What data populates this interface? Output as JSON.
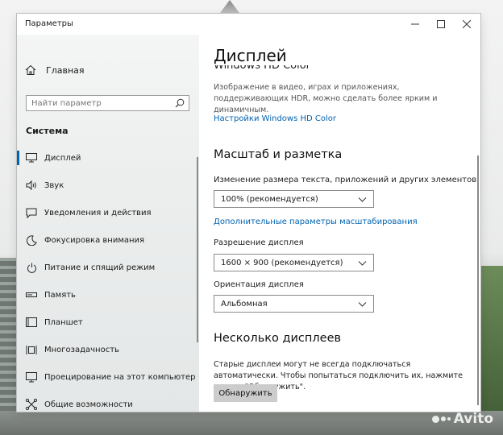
{
  "window": {
    "title": "Параметры",
    "controls": {
      "minimize": "minimize-icon",
      "maximize": "maximize-icon",
      "close": "close-icon"
    }
  },
  "sidebar": {
    "home_label": "Главная",
    "search_placeholder": "Найти параметр",
    "section_title": "Система",
    "items": [
      {
        "label": "Дисплей",
        "icon": "monitor-icon",
        "active": true
      },
      {
        "label": "Звук",
        "icon": "speaker-icon"
      },
      {
        "label": "Уведомления и действия",
        "icon": "notification-icon"
      },
      {
        "label": "Фокусировка внимания",
        "icon": "moon-icon"
      },
      {
        "label": "Питание и спящий режим",
        "icon": "power-icon"
      },
      {
        "label": "Память",
        "icon": "storage-icon"
      },
      {
        "label": "Планшет",
        "icon": "tablet-icon"
      },
      {
        "label": "Многозадачность",
        "icon": "multitasking-icon"
      },
      {
        "label": "Проецирование на этот компьютер",
        "icon": "projection-icon"
      },
      {
        "label": "Общие возможности",
        "icon": "shared-experiences-icon"
      }
    ]
  },
  "main": {
    "page_title": "Дисплей",
    "hdr_heading": "Windows HD Color",
    "hdr_description": "Изображение в видео, играх и приложениях, поддерживающих HDR, можно сделать более ярким и динамичным.",
    "hdr_link": "Настройки Windows HD Color",
    "scale_heading": "Масштаб и разметка",
    "text_size_label": "Изменение размера текста, приложений и других элементов",
    "text_size_value": "100% (рекомендуется)",
    "advanced_scale_link": "Дополнительные параметры масштабирования",
    "resolution_label": "Разрешение дисплея",
    "resolution_value": "1600 × 900 (рекомендуется)",
    "orientation_label": "Ориентация дисплея",
    "orientation_value": "Альбомная",
    "multi_heading": "Несколько дисплеев",
    "multi_description": "Старые дисплеи могут не всегда подключаться автоматически. Чтобы попытаться подключить их, нажмите кнопку \"Обнаружить\".",
    "detect_button": "Обнаружить"
  },
  "watermark": "Avito"
}
